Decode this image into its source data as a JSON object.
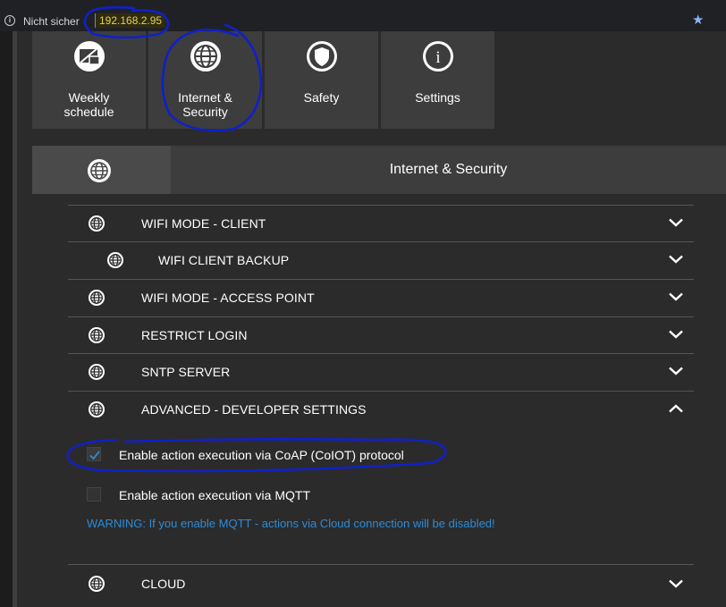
{
  "browser": {
    "not_secure_label": "Nicht sicher",
    "url": "192.168.2.95"
  },
  "tiles": [
    {
      "label_line1": "Weekly",
      "label_line2": "schedule",
      "icon": "schedule-icon"
    },
    {
      "label_line1": "Internet &",
      "label_line2": "Security",
      "icon": "globe-icon"
    },
    {
      "label_line1": "Safety",
      "label_line2": "",
      "icon": "shield-icon"
    },
    {
      "label_line1": "Settings",
      "label_line2": "",
      "icon": "info-icon"
    }
  ],
  "section": {
    "title": "Internet & Security",
    "icon": "globe-icon"
  },
  "rows": [
    {
      "label": "WIFI MODE - CLIENT",
      "expanded": false
    },
    {
      "label": "WIFI CLIENT BACKUP",
      "expanded": false
    },
    {
      "label": "WIFI MODE - ACCESS POINT",
      "expanded": false
    },
    {
      "label": "RESTRICT LOGIN",
      "expanded": false
    },
    {
      "label": "SNTP SERVER",
      "expanded": false
    },
    {
      "label": "ADVANCED - DEVELOPER SETTINGS",
      "expanded": true
    },
    {
      "label": "CLOUD",
      "expanded": false
    }
  ],
  "advanced": {
    "options": [
      {
        "label": "Enable action execution via CoAP (CoIOT) protocol",
        "checked": true
      },
      {
        "label": "Enable action execution via MQTT",
        "checked": false
      }
    ],
    "warning": "WARNING: If you enable MQTT - actions via Cloud connection will be disabled!"
  },
  "colors": {
    "accent_blue": "#2e8bd6",
    "annotation_ink": "#1020c8",
    "url_highlight": "#e8d24a",
    "panel": "#3d3d3d",
    "background": "#2b2b2b"
  }
}
